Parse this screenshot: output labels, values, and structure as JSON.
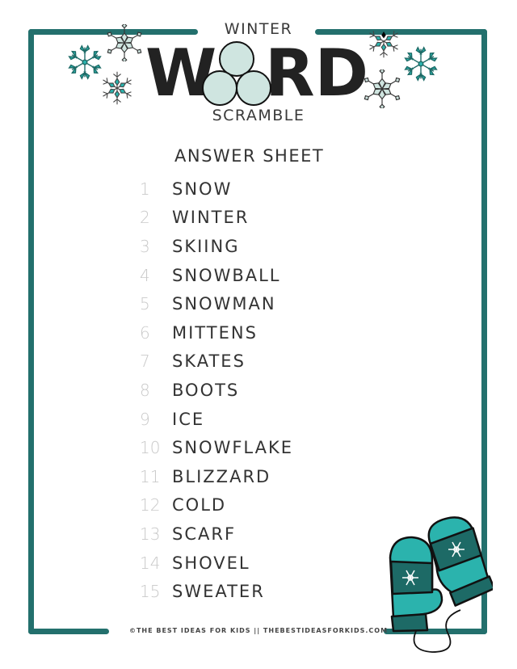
{
  "header": {
    "title_top": "WINTER",
    "title_main": "WORD",
    "title_bottom": "SCRAMBLE"
  },
  "answer_sheet": {
    "heading": "ANSWER SHEET",
    "items": [
      {
        "number": "1",
        "word": "SNOW"
      },
      {
        "number": "2",
        "word": "WINTER"
      },
      {
        "number": "3",
        "word": "SKIING"
      },
      {
        "number": "4",
        "word": "SNOWBALL"
      },
      {
        "number": "5",
        "word": "SNOWMAN"
      },
      {
        "number": "6",
        "word": "MITTENS"
      },
      {
        "number": "7",
        "word": "SKATES"
      },
      {
        "number": "8",
        "word": "BOOTS"
      },
      {
        "number": "9",
        "word": "ICE"
      },
      {
        "number": "10",
        "word": "SNOWFLAKE"
      },
      {
        "number": "11",
        "word": "BLIZZARD"
      },
      {
        "number": "12",
        "word": "COLD"
      },
      {
        "number": "13",
        "word": "SCARF"
      },
      {
        "number": "14",
        "word": "SHOVEL"
      },
      {
        "number": "15",
        "word": "SWEATER"
      }
    ]
  },
  "footer": {
    "text": "©THE BEST IDEAS FOR KIDS || THEBESTIDEASFORKIDS.COM"
  },
  "decorations": {
    "icons": [
      "snowflake-icon",
      "snowball-icon",
      "mittens-icon"
    ]
  },
  "colors": {
    "frame": "#23706d",
    "teal": "#2bb3ad",
    "dark_teal": "#1d6a66",
    "mint": "#cfe5e0",
    "ink": "#222222"
  }
}
